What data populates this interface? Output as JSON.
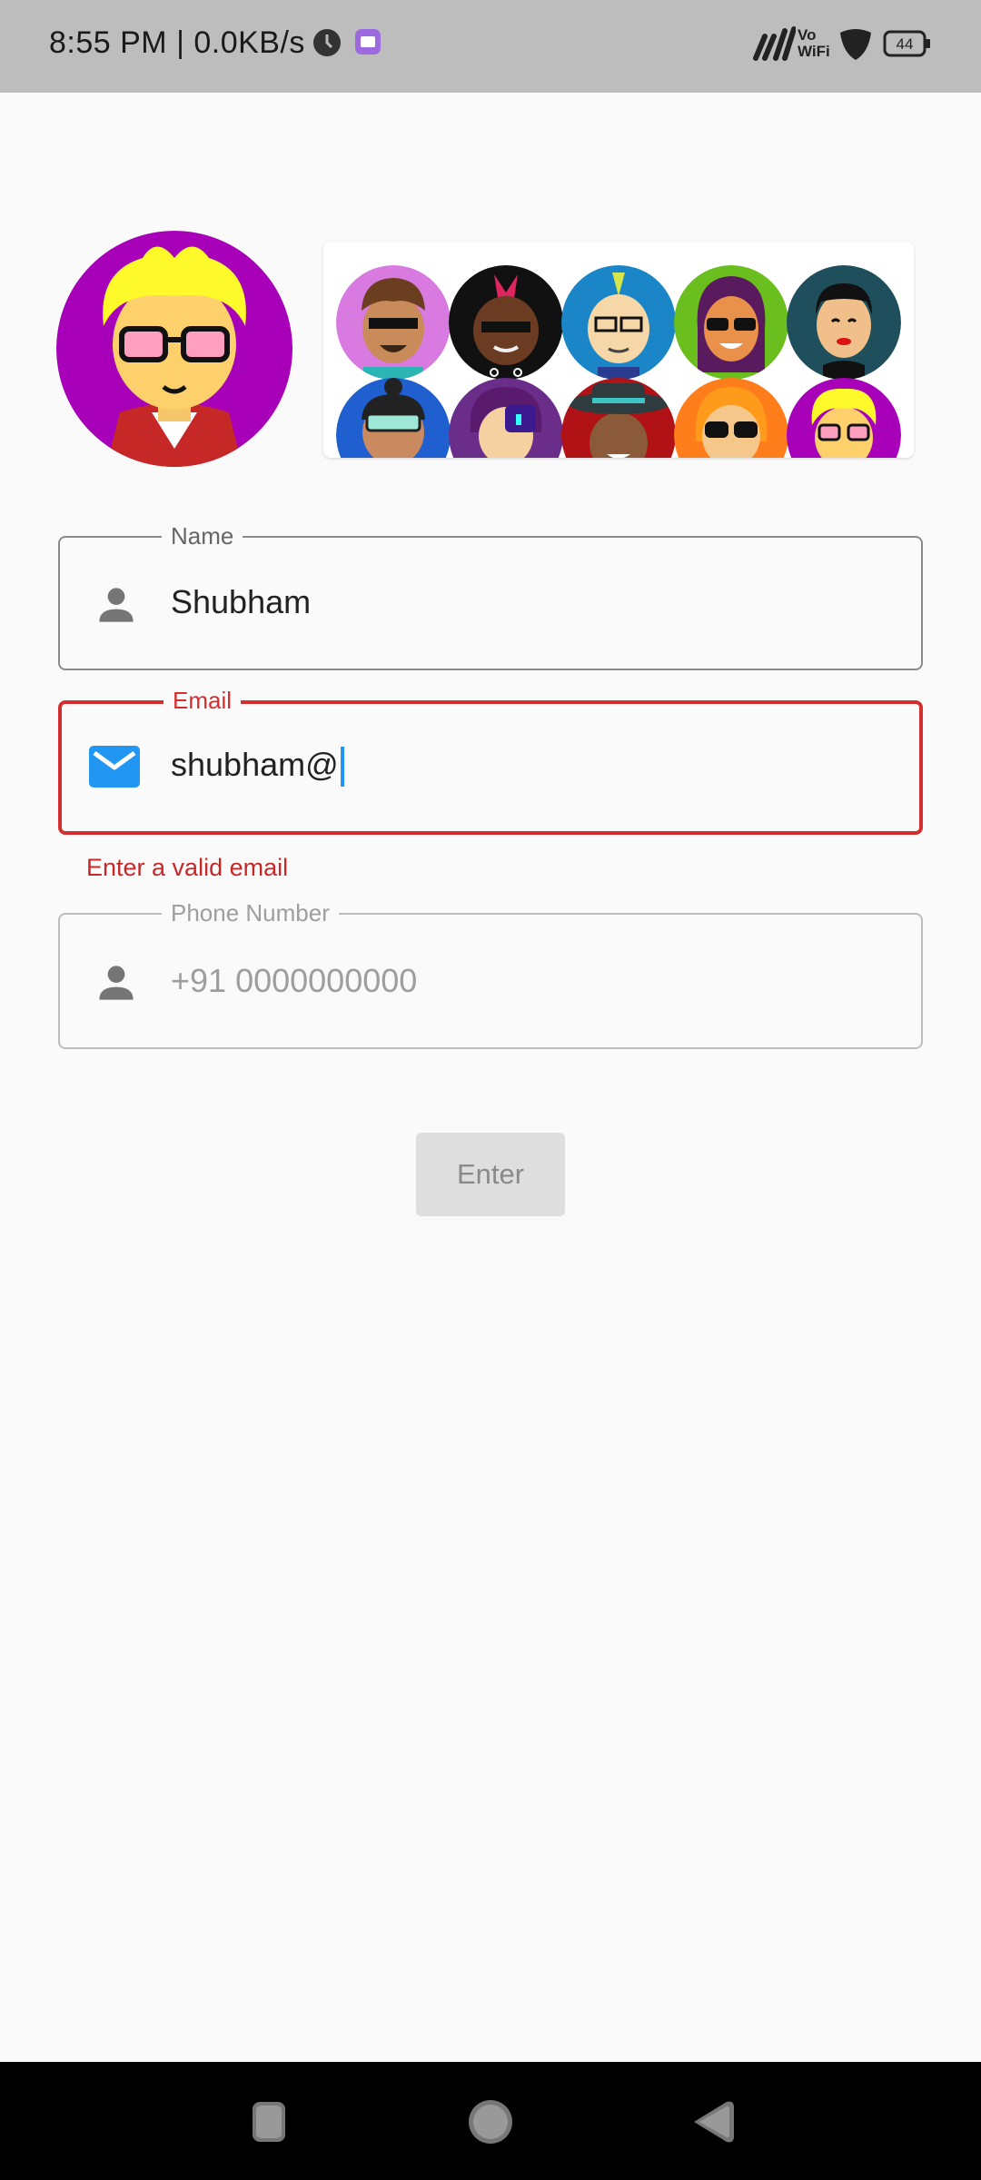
{
  "status_bar": {
    "time": "8:55 PM | 0.0KB/s",
    "battery": "44",
    "icons": [
      "clock-icon",
      "app-notification-icon",
      "signal-icon",
      "vowifi-icon",
      "shield-icon",
      "battery-icon"
    ]
  },
  "avatars": {
    "selected": "avatar-blond-pink-glasses",
    "options": [
      "avatar-curly-pixel-glasses",
      "avatar-red-mohawk-pixel-glasses",
      "avatar-green-mohawk-glasses",
      "avatar-purple-hair-sunglasses",
      "avatar-black-hair-red-lips",
      "avatar-topknot-goggles",
      "avatar-purple-hair-mask",
      "avatar-teal-hat",
      "avatar-orange-hair-sunglasses",
      "avatar-blond-pink-glasses"
    ]
  },
  "form": {
    "name": {
      "label": "Name",
      "value": "Shubham",
      "icon": "person-icon"
    },
    "email": {
      "label": "Email",
      "value": "shubham@",
      "icon": "mail-icon",
      "error": "Enter a valid email"
    },
    "phone": {
      "label": "Phone Number",
      "placeholder": "+91 0000000000",
      "icon": "person-icon"
    },
    "submit_label": "Enter"
  },
  "colors": {
    "error": "#d32f2f",
    "accent": "#2196f3",
    "status_bar": "#bdbdbd"
  },
  "nav_bar": {
    "icons": [
      "recents-icon",
      "home-icon",
      "back-icon"
    ]
  }
}
